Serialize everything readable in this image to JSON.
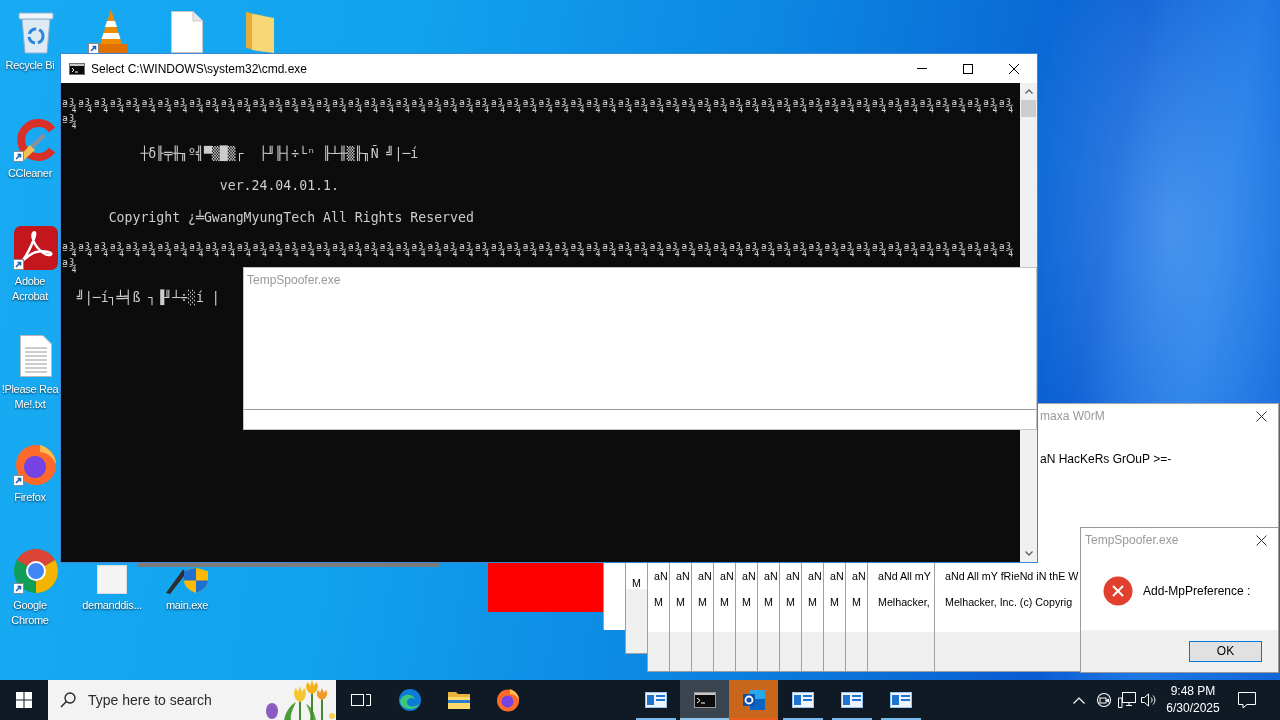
{
  "desktop_icons": [
    {
      "kind": "bin",
      "label_lines": [
        "Recycle Bi"
      ],
      "shortcut": false
    },
    {
      "kind": "cone",
      "shortcut": true
    },
    {
      "kind": "page",
      "shortcut": false
    },
    {
      "kind": "folder",
      "shortcut": false
    },
    {
      "kind": "cleaner",
      "label_lines": [
        "CCleaner"
      ],
      "shortcut": true
    },
    {
      "kind": "reader",
      "label_lines": [
        "Adobe",
        "Acrobat"
      ],
      "shortcut": true
    },
    {
      "kind": "notes",
      "label_lines": [
        "!Please Rea",
        "Me!.txt"
      ],
      "shortcut": false
    },
    {
      "kind": "firefox",
      "label_lines": [
        "Firefox"
      ],
      "shortcut": true
    },
    {
      "kind": "chrome",
      "label_lines": [
        "Google",
        "Chrome"
      ],
      "shortcut": true
    },
    {
      "kind": "blank",
      "label_lines": [
        "demanddis..."
      ],
      "shortcut": false
    },
    {
      "kind": "setup",
      "label_lines": [
        "main.exe"
      ],
      "shortcut": false
    }
  ],
  "console_window": {
    "title": "Select C:\\WINDOWS\\system32\\cmd.exe",
    "active": true,
    "blocks": [
      [
        "ª¾ª¾ª¾ª¾ª¾ª¾ª¾ª¾ª¾ª¾ª¾ª¾ª¾ª¾ª¾ª¾ª¾ª¾ª¾ª¾ª¾ª¾ª¾ª¾ª¾ª¾ª¾ª¾ª¾ª¾ª¾ª¾ª¾ª¾ª¾ª¾ª¾ª¾ª¾ª¾ª¾ª¾ª¾ª¾ª¾ª¾ª¾ª¾ª¾ª¾ª¾ª¾ª¾ª¾ª¾ª¾ª¾ª¾ª¾ª¾",
        "ª¾"
      ],
      [
        "          ┼δ╟╤╫╖º╣▀▒█▒┌  ├╜╟┤÷└ⁿ ╟┴╫▒╟╖Ñ ╝|─í"
      ],
      [
        "                    ver.24.04.01.1."
      ],
      [
        "      Copyright ¿╧GwangMyungTech All Rights Reserved"
      ],
      [
        "ª¾ª¾ª¾ª¾ª¾ª¾ª¾ª¾ª¾ª¾ª¾ª¾ª¾ª¾ª¾ª¾ª¾ª¾ª¾ª¾ª¾ª¾ª¾ª¾ª¾ª¾ª¾ª¾ª¾ª¾ª¾ª¾ª¾ª¾ª¾ª¾ª¾ª¾ª¾ª¾ª¾ª¾ª¾ª¾ª¾ª¾ª¾ª¾ª¾ª¾ª¾ª¾ª¾ª¾ª¾ª¾ª¾ª¾ª¾ª¾",
        "ª¾"
      ],
      [
        "  ╝|─í┐╧╡ß ┐▐╜┴÷░í |"
      ]
    ]
  },
  "spoofer_window": {
    "title": "TempSpoofer.exe",
    "active": false
  },
  "worm_window": {
    "title": "maxa W0rM",
    "active": false,
    "message": "aN HacKeRs GrOuP >=-"
  },
  "message_stack": [
    {
      "lines": [
        "M"
      ]
    },
    {
      "lines": [
        "aN",
        "M"
      ]
    },
    {
      "lines": [
        "aN",
        "M"
      ]
    },
    {
      "lines": [
        "aN",
        "M"
      ]
    },
    {
      "lines": [
        "aN",
        "M"
      ]
    },
    {
      "lines": [
        "aN",
        "M"
      ]
    },
    {
      "lines": [
        "aN",
        "M"
      ]
    },
    {
      "lines": [
        "aN",
        "M"
      ]
    },
    {
      "lines": [
        "aN",
        "M"
      ]
    },
    {
      "lines": [
        "aN",
        "M"
      ]
    },
    {
      "lines": [
        "aN",
        "M"
      ]
    },
    {
      "lines": [
        "aNd All mY",
        "Melhacker,"
      ]
    },
    {
      "lines": [
        "aNd All mY fRieNd iN thE W",
        "Melhacker, Inc. (c) Copyrig"
      ]
    }
  ],
  "error_dialog": {
    "title": "TempSpoofer.exe",
    "active": false,
    "message": "Add-MpPreference :",
    "button": "OK"
  },
  "taskbar": {
    "search": {
      "placeholder": "Type here to search"
    },
    "pinned": [
      {
        "kind": "task-view"
      },
      {
        "kind": "edge"
      },
      {
        "kind": "explorer"
      },
      {
        "kind": "firefox"
      }
    ],
    "windows": [
      {
        "kind": "app-window",
        "active": false,
        "flashing": false
      },
      {
        "kind": "console",
        "active": true,
        "flashing": false
      },
      {
        "kind": "outlook",
        "active": false,
        "flashing": true
      },
      {
        "kind": "app-window",
        "active": false,
        "flashing": false
      },
      {
        "kind": "app-window",
        "active": false,
        "flashing": false
      },
      {
        "kind": "app-window",
        "active": false,
        "flashing": false
      }
    ],
    "tray": [
      {
        "kind": "chevron"
      },
      {
        "kind": "camera"
      },
      {
        "kind": "network"
      },
      {
        "kind": "volume"
      }
    ],
    "clock": {
      "time": "9:48 PM",
      "date": "6/30/2025"
    }
  }
}
